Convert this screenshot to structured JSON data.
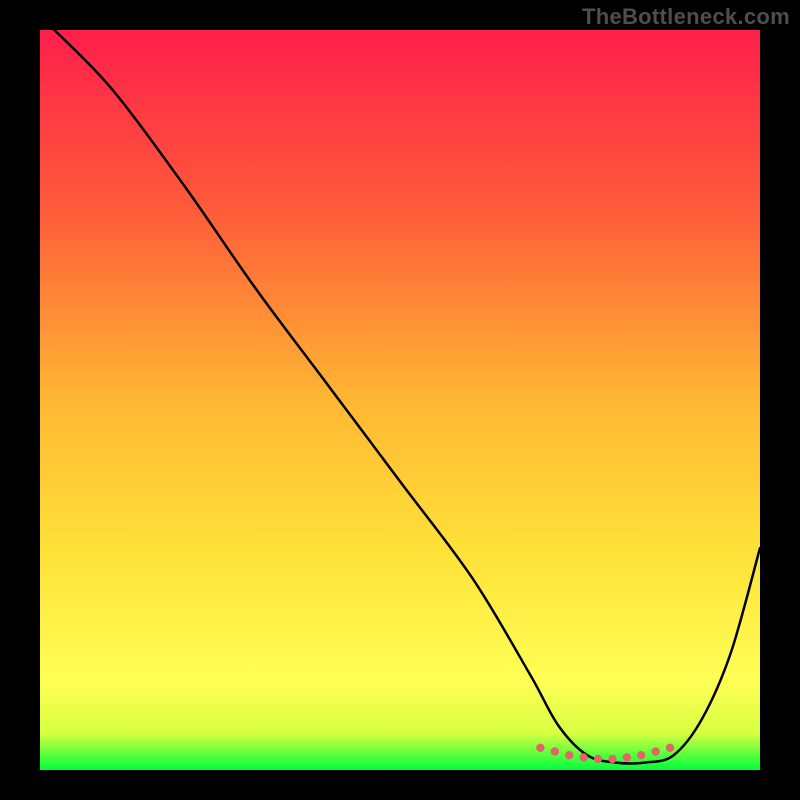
{
  "watermark_text": "TheBottleneck.com",
  "plot": {
    "colors": {
      "top": "#ff1f4b",
      "mid": "#ffd400",
      "near_bottom": "#ffff55",
      "bottom": "#00ff3c",
      "curve": "#000000",
      "marker": "#e06666"
    }
  },
  "chart_data": {
    "type": "line",
    "title": "",
    "xlabel": "",
    "ylabel": "",
    "xlim": [
      0,
      100
    ],
    "ylim": [
      0,
      100
    ],
    "series": [
      {
        "name": "curve",
        "x": [
          2,
          10,
          20,
          30,
          40,
          50,
          60,
          68,
          72,
          76,
          80,
          84,
          88,
          92,
          96,
          100
        ],
        "y": [
          100,
          92,
          79,
          65,
          52,
          39,
          26,
          13,
          6,
          2,
          1,
          1,
          2,
          7,
          16,
          30
        ]
      }
    ],
    "markers": {
      "name": "dotted-trough",
      "x": [
        69.5,
        71.5,
        73.5,
        75.5,
        77.5,
        79.5,
        81.5,
        83.5,
        85.5,
        87.5
      ],
      "y": [
        3.0,
        2.5,
        2.0,
        1.7,
        1.5,
        1.5,
        1.7,
        2.0,
        2.5,
        3.0
      ]
    }
  }
}
